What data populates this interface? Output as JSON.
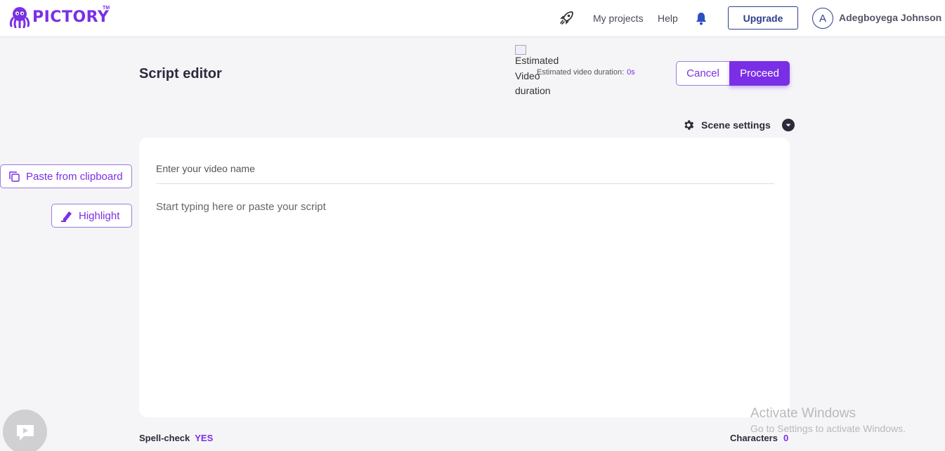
{
  "brand": {
    "name": "PICTORY",
    "tm": "TM",
    "color": "#7a2fe6"
  },
  "nav": {
    "rocket_icon": "rocket-icon",
    "my_projects": "My projects",
    "help": "Help",
    "bell_icon": "bell-icon",
    "upgrade": "Upgrade",
    "avatar_letter": "A",
    "user_name": "Adegboyega Johnson"
  },
  "header": {
    "title": "Script editor",
    "broken_image_alt": "Estimated Video duration",
    "estimated_label": "Estimated video duration:",
    "estimated_value": "0s",
    "cancel": "Cancel",
    "proceed": "Proceed"
  },
  "scene_settings": {
    "label": "Scene settings"
  },
  "editor": {
    "name_placeholder": "Enter your video name",
    "script_placeholder": "Start typing here or paste your script"
  },
  "side_actions": {
    "paste": "Paste from clipboard",
    "highlight": "Highlight"
  },
  "footer": {
    "spellcheck_label": "Spell-check",
    "spellcheck_value": "YES",
    "characters_label": "Characters",
    "characters_value": "0"
  },
  "watermark": {
    "line1": "Activate Windows",
    "line2": "Go to Settings to activate Windows."
  }
}
